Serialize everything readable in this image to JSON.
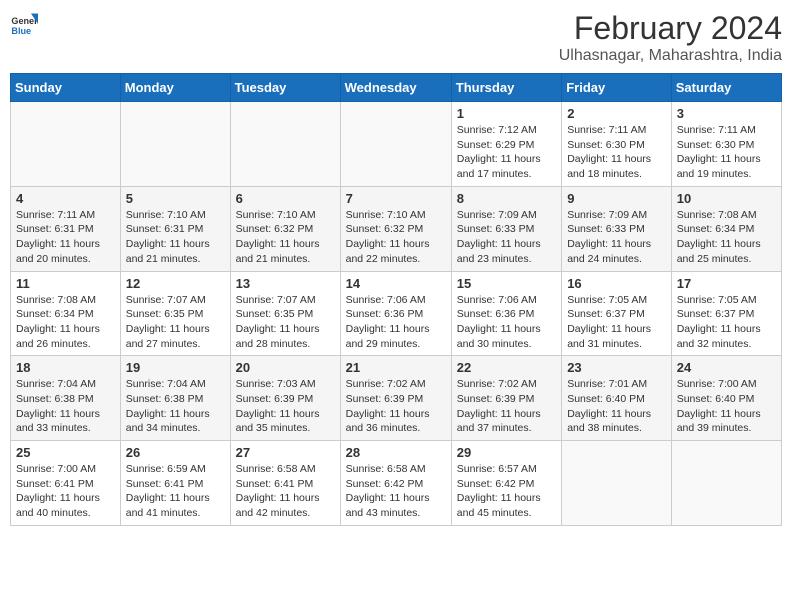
{
  "header": {
    "logo_general": "General",
    "logo_blue": "Blue",
    "title": "February 2024",
    "subtitle": "Ulhasnagar, Maharashtra, India"
  },
  "days_of_week": [
    "Sunday",
    "Monday",
    "Tuesday",
    "Wednesday",
    "Thursday",
    "Friday",
    "Saturday"
  ],
  "weeks": [
    [
      {
        "day": "",
        "info": ""
      },
      {
        "day": "",
        "info": ""
      },
      {
        "day": "",
        "info": ""
      },
      {
        "day": "",
        "info": ""
      },
      {
        "day": "1",
        "info": "Sunrise: 7:12 AM\nSunset: 6:29 PM\nDaylight: 11 hours and 17 minutes."
      },
      {
        "day": "2",
        "info": "Sunrise: 7:11 AM\nSunset: 6:30 PM\nDaylight: 11 hours and 18 minutes."
      },
      {
        "day": "3",
        "info": "Sunrise: 7:11 AM\nSunset: 6:30 PM\nDaylight: 11 hours and 19 minutes."
      }
    ],
    [
      {
        "day": "4",
        "info": "Sunrise: 7:11 AM\nSunset: 6:31 PM\nDaylight: 11 hours and 20 minutes."
      },
      {
        "day": "5",
        "info": "Sunrise: 7:10 AM\nSunset: 6:31 PM\nDaylight: 11 hours and 21 minutes."
      },
      {
        "day": "6",
        "info": "Sunrise: 7:10 AM\nSunset: 6:32 PM\nDaylight: 11 hours and 21 minutes."
      },
      {
        "day": "7",
        "info": "Sunrise: 7:10 AM\nSunset: 6:32 PM\nDaylight: 11 hours and 22 minutes."
      },
      {
        "day": "8",
        "info": "Sunrise: 7:09 AM\nSunset: 6:33 PM\nDaylight: 11 hours and 23 minutes."
      },
      {
        "day": "9",
        "info": "Sunrise: 7:09 AM\nSunset: 6:33 PM\nDaylight: 11 hours and 24 minutes."
      },
      {
        "day": "10",
        "info": "Sunrise: 7:08 AM\nSunset: 6:34 PM\nDaylight: 11 hours and 25 minutes."
      }
    ],
    [
      {
        "day": "11",
        "info": "Sunrise: 7:08 AM\nSunset: 6:34 PM\nDaylight: 11 hours and 26 minutes."
      },
      {
        "day": "12",
        "info": "Sunrise: 7:07 AM\nSunset: 6:35 PM\nDaylight: 11 hours and 27 minutes."
      },
      {
        "day": "13",
        "info": "Sunrise: 7:07 AM\nSunset: 6:35 PM\nDaylight: 11 hours and 28 minutes."
      },
      {
        "day": "14",
        "info": "Sunrise: 7:06 AM\nSunset: 6:36 PM\nDaylight: 11 hours and 29 minutes."
      },
      {
        "day": "15",
        "info": "Sunrise: 7:06 AM\nSunset: 6:36 PM\nDaylight: 11 hours and 30 minutes."
      },
      {
        "day": "16",
        "info": "Sunrise: 7:05 AM\nSunset: 6:37 PM\nDaylight: 11 hours and 31 minutes."
      },
      {
        "day": "17",
        "info": "Sunrise: 7:05 AM\nSunset: 6:37 PM\nDaylight: 11 hours and 32 minutes."
      }
    ],
    [
      {
        "day": "18",
        "info": "Sunrise: 7:04 AM\nSunset: 6:38 PM\nDaylight: 11 hours and 33 minutes."
      },
      {
        "day": "19",
        "info": "Sunrise: 7:04 AM\nSunset: 6:38 PM\nDaylight: 11 hours and 34 minutes."
      },
      {
        "day": "20",
        "info": "Sunrise: 7:03 AM\nSunset: 6:39 PM\nDaylight: 11 hours and 35 minutes."
      },
      {
        "day": "21",
        "info": "Sunrise: 7:02 AM\nSunset: 6:39 PM\nDaylight: 11 hours and 36 minutes."
      },
      {
        "day": "22",
        "info": "Sunrise: 7:02 AM\nSunset: 6:39 PM\nDaylight: 11 hours and 37 minutes."
      },
      {
        "day": "23",
        "info": "Sunrise: 7:01 AM\nSunset: 6:40 PM\nDaylight: 11 hours and 38 minutes."
      },
      {
        "day": "24",
        "info": "Sunrise: 7:00 AM\nSunset: 6:40 PM\nDaylight: 11 hours and 39 minutes."
      }
    ],
    [
      {
        "day": "25",
        "info": "Sunrise: 7:00 AM\nSunset: 6:41 PM\nDaylight: 11 hours and 40 minutes."
      },
      {
        "day": "26",
        "info": "Sunrise: 6:59 AM\nSunset: 6:41 PM\nDaylight: 11 hours and 41 minutes."
      },
      {
        "day": "27",
        "info": "Sunrise: 6:58 AM\nSunset: 6:41 PM\nDaylight: 11 hours and 42 minutes."
      },
      {
        "day": "28",
        "info": "Sunrise: 6:58 AM\nSunset: 6:42 PM\nDaylight: 11 hours and 43 minutes."
      },
      {
        "day": "29",
        "info": "Sunrise: 6:57 AM\nSunset: 6:42 PM\nDaylight: 11 hours and 45 minutes."
      },
      {
        "day": "",
        "info": ""
      },
      {
        "day": "",
        "info": ""
      }
    ]
  ]
}
